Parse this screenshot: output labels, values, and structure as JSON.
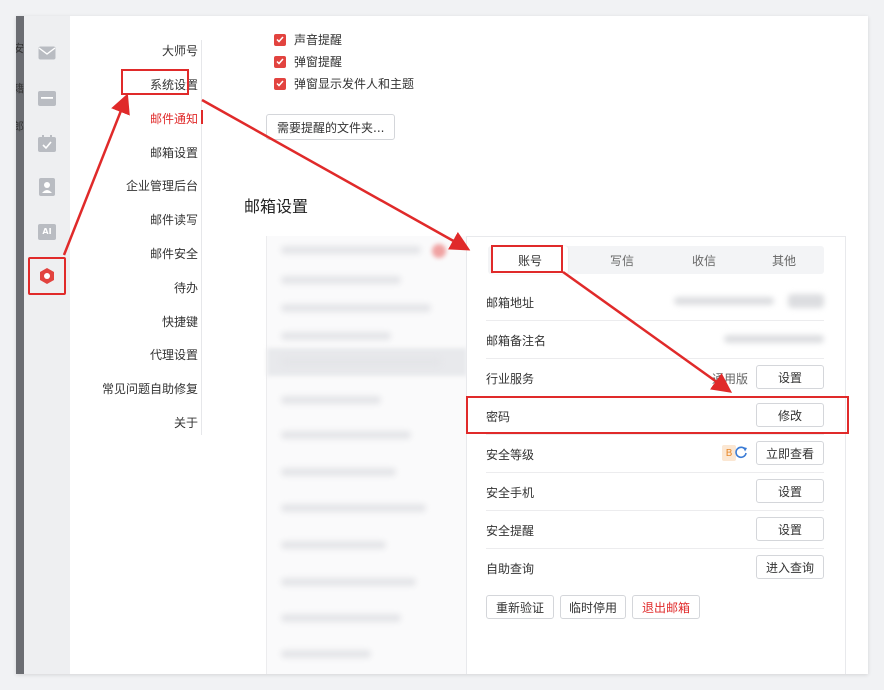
{
  "left_edge_chars": [
    "安",
    "籍",
    "郎"
  ],
  "iconbar": {
    "icons": [
      {
        "name": "mail-icon"
      },
      {
        "name": "folder-icon"
      },
      {
        "name": "calendar-icon"
      },
      {
        "name": "contacts-icon"
      },
      {
        "name": "ai-icon",
        "label": "AI"
      },
      {
        "name": "settings-gear-icon"
      }
    ]
  },
  "nav": {
    "items": [
      {
        "label": "大师号"
      },
      {
        "label": "系统设置"
      },
      {
        "label": "邮件通知"
      },
      {
        "label": "邮箱设置"
      },
      {
        "label": "企业管理后台"
      },
      {
        "label": "邮件读写"
      },
      {
        "label": "邮件安全"
      },
      {
        "label": "待办"
      },
      {
        "label": "快捷键"
      },
      {
        "label": "代理设置"
      },
      {
        "label": "常见问题自助修复"
      },
      {
        "label": "关于"
      }
    ],
    "selected": "邮件通知"
  },
  "notify": {
    "checkboxes": [
      {
        "label": "声音提醒",
        "checked": true
      },
      {
        "label": "弹窗提醒",
        "checked": true
      },
      {
        "label": "弹窗显示发件人和主题",
        "checked": true
      }
    ],
    "folder_button": "需要提醒的文件夹..."
  },
  "mailbox_settings": {
    "title": "邮箱设置",
    "tabs": [
      {
        "label": "账号",
        "selected": true
      },
      {
        "label": "写信"
      },
      {
        "label": "收信"
      },
      {
        "label": "其他"
      }
    ],
    "rows": {
      "address": {
        "label": "邮箱地址"
      },
      "remark": {
        "label": "邮箱备注名"
      },
      "service": {
        "label": "行业服务",
        "value": "通用版",
        "button": "设置"
      },
      "password": {
        "label": "密码",
        "button": "修改"
      },
      "security_level": {
        "label": "安全等级",
        "badge": "B",
        "button": "立即查看"
      },
      "security_phone": {
        "label": "安全手机",
        "button": "设置"
      },
      "security_reminder": {
        "label": "安全提醒",
        "button": "设置"
      },
      "self_query": {
        "label": "自助查询",
        "button": "进入查询"
      }
    },
    "actions": {
      "reverify": "重新验证",
      "suspend": "临时停用",
      "logout": "退出邮箱"
    }
  },
  "colors": {
    "accent_red": "#e02a2a",
    "checkbox_red": "#e2433f",
    "refresh_blue": "#3a7bd5",
    "badge_orange": "#e88a2c"
  }
}
